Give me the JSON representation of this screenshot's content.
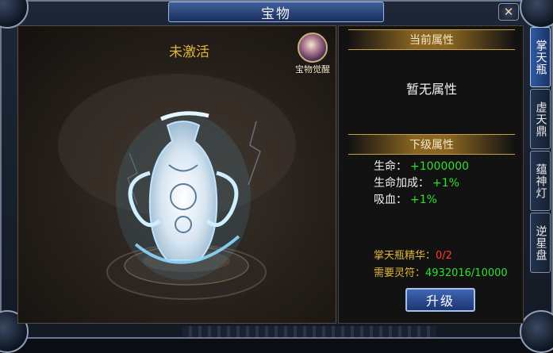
{
  "window": {
    "title": "宝物",
    "close_label": "✕"
  },
  "treasure": {
    "status": "未激活",
    "awaken_label": "宝物觉醒"
  },
  "current_attributes": {
    "header": "当前属性",
    "empty_text": "暂无属性"
  },
  "next_attributes": {
    "header": "下级属性",
    "rows": [
      {
        "label": "生命：",
        "value": "+1000000"
      },
      {
        "label": "生命加成：",
        "value": "+1%"
      },
      {
        "label": "吸血：",
        "value": "+1%"
      }
    ]
  },
  "requirements": {
    "essence_label": "掌天瓶精华：",
    "essence_value": "0/2",
    "talisman_label": "需要灵符：",
    "talisman_value": "4932016/10000"
  },
  "upgrade_button": "升级",
  "tabs": [
    "掌天瓶",
    "虚天鼎",
    "蕴神灯",
    "逆星盘"
  ],
  "colors": {
    "accent_gold": "#e0b53a",
    "value_green": "#2ee02e",
    "warn_red": "#ff3b30",
    "tab_active": "#2f5aa0"
  }
}
